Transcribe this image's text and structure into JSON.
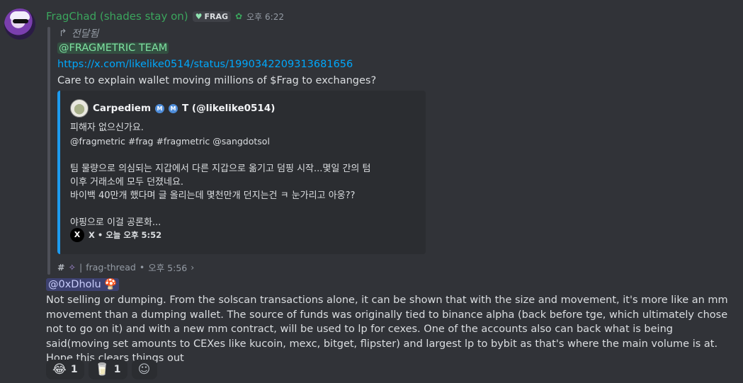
{
  "message": {
    "username": "FragChad (shades stay on)",
    "tag": "FRAG",
    "timestamp": "오후 6:22",
    "forwarded_label": "전달됨",
    "mention": "@FRAGMETRIC TEAM",
    "link": "https://x.com/likelike0514/status/1990342209313681656",
    "text": "Care to explain wallet moving millions of $Frag to exchanges?"
  },
  "embed": {
    "author": "Carpediem",
    "author_suffix": "T (@likelike0514)",
    "line1": "피해자 없으신가요.",
    "line2": "@fragmetric #frag #fragmetric @sangdotsol",
    "line3": "팀 물량으로 의심되는 지갑에서 다른 지갑으로 옮기고 덤핑 시작...몇일 간의 텀",
    "line4": "이후 거래소에 모두 던졌네요.",
    "line5": "바이백 40만개 했다며 글 올리는데 몇천만개 던지는건 ㅋ 눈가리고 아웅??",
    "line6": "야핑으로 이걸 공론화...",
    "footer": "X • 오늘 오후 5:52",
    "accent_color": "#1d9bf0"
  },
  "thread": {
    "hash": "#",
    "name": "frag-thread",
    "time": "오후 5:56",
    "chevron": "›"
  },
  "reply": {
    "mention": "@0xDholu",
    "text": "Not selling or dumping. From the solscan transactions alone, it can be shown that with the size and movement, it's more like an mm movement than a dumping wallet. The source of funds was originally tied to binance alpha (back before tge, which ultimately chose not to go on it) and with a new mm contract, will be used to lp for cexes. One of the accounts also can back what is being said(moving set amounts to CEXes like kucoin, mexc, bitget, flipster) and largest lp to bybit as that's where the main volume is at. Hope this clears things out"
  },
  "reactions": [
    {
      "emoji": "😂",
      "count": "1"
    },
    {
      "emoji": "🥛",
      "count": "1"
    }
  ],
  "colors": {
    "background": "#313338",
    "username": "#3ba55d",
    "link": "#00a8fc"
  }
}
